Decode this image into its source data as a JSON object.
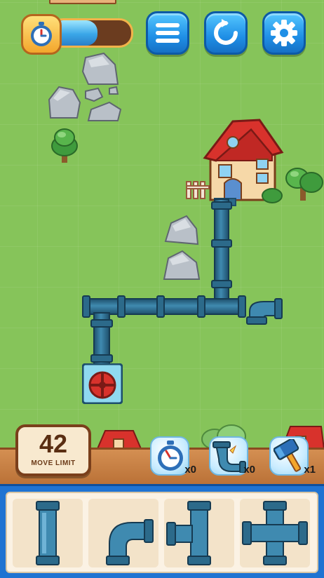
{
  "hud": {
    "timer_progress": 0.58,
    "buttons": [
      "menu-icon",
      "restart-icon",
      "settings-icon"
    ]
  },
  "level": {
    "moves_remaining": "42",
    "move_limit_label": "MOVE LIMIT"
  },
  "boosters": [
    {
      "name": "time-freeze",
      "icon": "stopwatch-icon",
      "count": "x0"
    },
    {
      "name": "pipe-fix",
      "icon": "broken-pipe-icon",
      "count": "x0"
    },
    {
      "name": "hammer",
      "icon": "hammer-icon",
      "count": "x1"
    }
  ],
  "piece_tray": [
    {
      "name": "straight-pipe",
      "icon": "straight-pipe-icon"
    },
    {
      "name": "elbow-pipe",
      "icon": "elbow-pipe-icon"
    },
    {
      "name": "tee-pipe",
      "icon": "tee-pipe-icon"
    },
    {
      "name": "cross-pipe",
      "icon": "cross-pipe-icon"
    }
  ],
  "colors": {
    "grass": "#86c45a",
    "pipe": "#2c6a8a",
    "pipe_joint": "#1e4f6b",
    "hud_button": "#1f8fe6",
    "tray_border": "#1f73d2",
    "roof": "#d8322c"
  }
}
